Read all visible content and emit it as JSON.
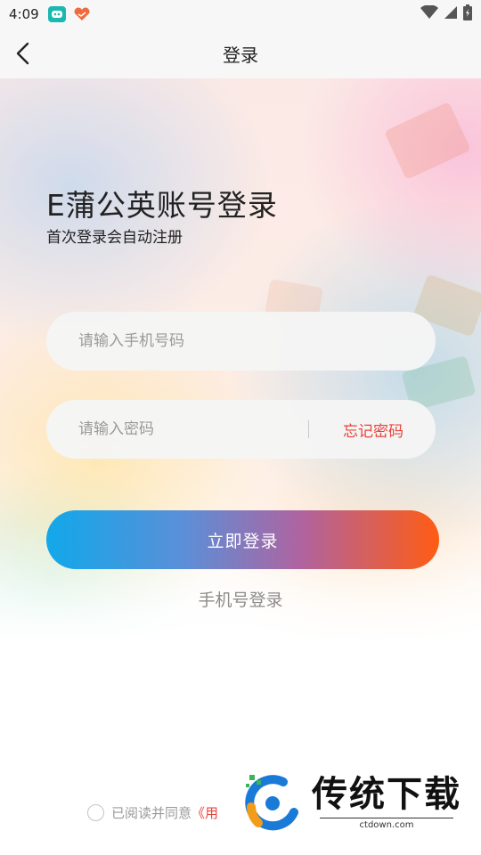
{
  "status_bar": {
    "time": "4:09",
    "icons": [
      "app-badge-icon",
      "heart-app-icon",
      "wifi-icon",
      "signal-icon",
      "battery-icon"
    ]
  },
  "header": {
    "title": "登录",
    "back_icon": "chevron-left-icon"
  },
  "main": {
    "title": "E蒲公英账号登录",
    "subtitle": "首次登录会自动注册",
    "phone_input": {
      "placeholder": "请输入手机号码",
      "value": ""
    },
    "password_input": {
      "placeholder": "请输入密码",
      "value": ""
    },
    "forgot_password_label": "忘记密码",
    "login_button_label": "立即登录",
    "alt_login_label": "手机号登录"
  },
  "agreement": {
    "prefix": "已阅读并同意",
    "link_text": "《用"
  },
  "watermark": {
    "title": "传统下载",
    "url": "ctdown.com"
  },
  "colors": {
    "accent_red": "#e8433a",
    "button_gradient_start": "#11a8ea",
    "button_gradient_end": "#ff5c13",
    "placeholder_gray": "#9a9a9a"
  }
}
